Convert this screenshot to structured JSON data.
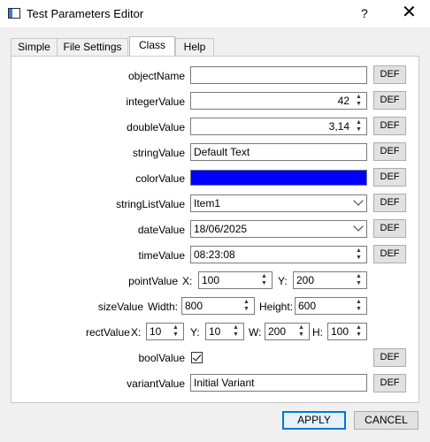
{
  "window": {
    "title": "Test Parameters Editor",
    "help_glyph": "?",
    "close_glyph": "✕"
  },
  "tabs": [
    {
      "label": "Simple",
      "active": false
    },
    {
      "label": "File Settings",
      "active": false
    },
    {
      "label": "Class",
      "active": true
    },
    {
      "label": "Help",
      "active": false
    }
  ],
  "fields": {
    "objectName": {
      "label": "objectName",
      "value": ""
    },
    "integerValue": {
      "label": "integerValue",
      "value": "42"
    },
    "doubleValue": {
      "label": "doubleValue",
      "value": "3,14"
    },
    "stringValue": {
      "label": "stringValue",
      "value": "Default Text"
    },
    "colorValue": {
      "label": "colorValue",
      "color": "#0000ff"
    },
    "stringListValue": {
      "label": "stringListValue",
      "value": "Item1"
    },
    "dateValue": {
      "label": "dateValue",
      "value": "18/06/2025"
    },
    "timeValue": {
      "label": "timeValue",
      "value": "08:23:08"
    },
    "pointValue": {
      "label": "pointValue",
      "x_label": "X:",
      "x": "100",
      "y_label": "Y:",
      "y": "200"
    },
    "sizeValue": {
      "label": "sizeValue",
      "width_label": "Width:",
      "width": "800",
      "height_label": "Height:",
      "height": "600"
    },
    "rectValue": {
      "label": "rectValue",
      "x_label": "X:",
      "x": "10",
      "y_label": "Y:",
      "y": "10",
      "w_label": "W:",
      "w": "200",
      "h_label": "H:",
      "h": "100"
    },
    "boolValue": {
      "label": "boolValue",
      "checked": true
    },
    "variantValue": {
      "label": "variantValue",
      "value": "Initial Variant"
    }
  },
  "def_label": "DEF",
  "buttons": {
    "apply": "APPLY",
    "cancel": "CANCEL"
  },
  "colors": {
    "accent": "#0078d7"
  }
}
